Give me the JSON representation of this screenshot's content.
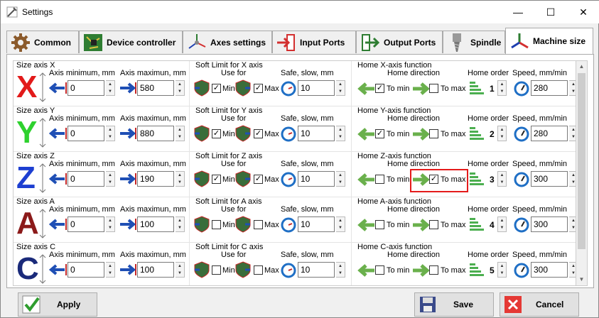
{
  "window": {
    "title": "Settings",
    "minimize": "—",
    "maximize": "☐",
    "close": "✕"
  },
  "tabs": [
    {
      "label": "Common",
      "icon": "gear-icon"
    },
    {
      "label": "Device controller",
      "icon": "circuit-board-icon"
    },
    {
      "label": "Axes settings",
      "icon": "axes-icon"
    },
    {
      "label": "Input Ports",
      "icon": "input-port-icon"
    },
    {
      "label": "Output Ports",
      "icon": "output-port-icon"
    },
    {
      "label": "Spindle",
      "icon": "spindle-icon"
    },
    {
      "label": "Machine size",
      "icon": "machine-size-icon",
      "active": true
    }
  ],
  "labels": {
    "axis_min": "Axis minimum, mm",
    "axis_max": "Axis maximun, mm",
    "use_for": "Use for",
    "safe_slow": "Safe, slow, mm",
    "home_dir": "Home direction",
    "home_order": "Home order",
    "speed": "Speed, mm/min",
    "min": "Min",
    "max": "Max",
    "to_min": "To min",
    "to_max": "To max"
  },
  "axes": [
    {
      "letter": "X",
      "color": "#e21a1a",
      "size_title": "Size axis X",
      "min": "0",
      "max": "580",
      "soft_title": "Soft Limit for X axis",
      "soft_min": true,
      "soft_max": true,
      "safe": "10",
      "home_title": "Home X-axis function",
      "to_min": true,
      "to_max": false,
      "order": "1",
      "speed": "280"
    },
    {
      "letter": "Y",
      "color": "#2ed12e",
      "size_title": "Size axis Y",
      "min": "0",
      "max": "880",
      "soft_title": "Soft Limit for Y axis",
      "soft_min": true,
      "soft_max": true,
      "safe": "10",
      "home_title": "Home Y-axis function",
      "to_min": true,
      "to_max": false,
      "order": "2",
      "speed": "280"
    },
    {
      "letter": "Z",
      "color": "#1d3fd1",
      "size_title": "Size axis Z",
      "min": "0",
      "max": "190",
      "soft_title": "Soft Limit for Z axis",
      "soft_min": true,
      "soft_max": true,
      "safe": "10",
      "home_title": "Home Z-axis function",
      "to_min": false,
      "to_max": true,
      "order": "3",
      "speed": "300"
    },
    {
      "letter": "A",
      "color": "#8b1a1a",
      "size_title": "Size axis A",
      "min": "0",
      "max": "100",
      "soft_title": "Soft Limit for A axis",
      "soft_min": false,
      "soft_max": false,
      "safe": "10",
      "home_title": "Home A-axis function",
      "to_min": false,
      "to_max": false,
      "order": "4",
      "speed": "300"
    },
    {
      "letter": "C",
      "color": "#1a2a7a",
      "size_title": "Size axis C",
      "min": "0",
      "max": "100",
      "soft_title": "Soft Limit for C axis",
      "soft_min": false,
      "soft_max": false,
      "safe": "10",
      "home_title": "Home C-axis function",
      "to_min": false,
      "to_max": false,
      "order": "5",
      "speed": "300"
    }
  ],
  "buttons": {
    "apply": "Apply",
    "save": "Save",
    "cancel": "Cancel"
  }
}
